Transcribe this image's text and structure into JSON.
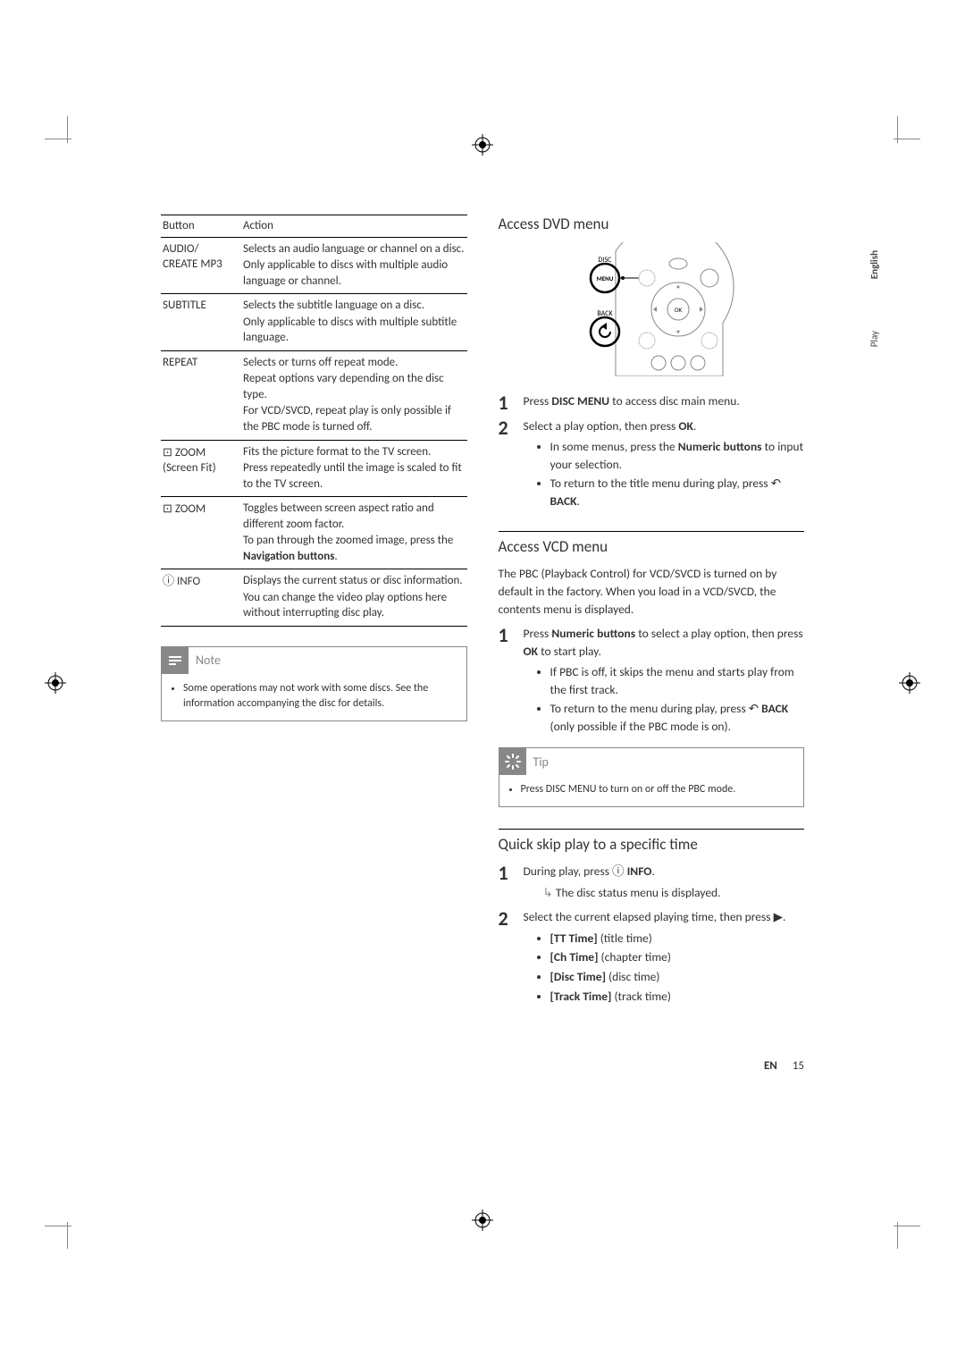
{
  "side_labels": {
    "english": "English",
    "play": "Play"
  },
  "table": {
    "header_button": "Button",
    "header_action": "Action",
    "rows": [
      {
        "button": "AUDIO/\nCREATE MP3",
        "actions": [
          "Selects an audio language or channel on a disc.",
          "Only applicable to discs with multiple audio language or channel."
        ]
      },
      {
        "button": "SUBTITLE",
        "actions": [
          "Selects the subtitle language on a disc.",
          "Only applicable to discs with multiple subtitle language."
        ]
      },
      {
        "button": "REPEAT",
        "actions": [
          "Selects or turns off repeat mode.",
          "Repeat options vary depending on the disc type.",
          "For VCD/SVCD, repeat play is only possible if the PBC mode is turned off."
        ]
      },
      {
        "button_icon": "⊡",
        "button": "ZOOM",
        "button_sub": "(Screen Fit)",
        "actions": [
          "Fits the picture format to the TV screen.",
          "Press repeatedly until the image is scaled to fit to the TV screen."
        ]
      },
      {
        "button_icon": "⊡",
        "button": "ZOOM",
        "actions": [
          "Toggles between screen aspect ratio and different zoom factor.",
          "To pan through the zoomed image, press the <b>Navigation buttons</b>."
        ]
      },
      {
        "button_icon": "ⓘ",
        "button": "INFO",
        "actions": [
          "Displays the current status or disc information.",
          "You can change the video play options here without interrupting disc play."
        ]
      }
    ]
  },
  "note": {
    "title": "Note",
    "items": [
      "Some operations may not work with some discs. See the information accompanying the disc for details."
    ]
  },
  "dvd": {
    "title": "Access DVD menu",
    "remote_labels": {
      "disc": "DISC",
      "menu": "MENU",
      "back": "BACK",
      "ok": "OK"
    },
    "step1": "Press <b>DISC MENU</b> to access disc main menu.",
    "step2": "Select a play option, then press <b>OK</b>.",
    "sub": [
      "In some menus, press the <b>Numeric buttons</b> to input your selection.",
      "To return to the title menu during play, press <span class='icon-glyph'>↶</span> <b>BACK</b>."
    ]
  },
  "vcd": {
    "title": "Access VCD menu",
    "intro": "The PBC (Playback Control) for VCD/SVCD is turned on by default in the factory. When you load in a VCD/SVCD, the contents menu is displayed.",
    "step1": "Press <b>Numeric buttons</b> to select a play option, then press <b>OK</b> to start play.",
    "sub": [
      "If PBC is off, it skips the menu and starts play from the first track.",
      "To return to the menu during play, press <span class='icon-glyph'>↶</span> <b>BACK</b> (only possible if the PBC mode is on)."
    ]
  },
  "tip": {
    "title": "Tip",
    "items": [
      "Press DISC MENU to turn on or off the PBC mode."
    ]
  },
  "quick": {
    "title": "Quick skip play to a specific time",
    "step1": "During play, press <span class='icon-glyph'>ⓘ</span> <b>INFO</b>.",
    "step1_result": "The disc status menu is displayed.",
    "step2": "Select the current elapsed playing time, then press <span class='icon-glyph'>▶</span>.",
    "options": [
      "<b>[TT Time]</b> (title time)",
      "<b>[Ch Time]</b> (chapter time)",
      "<b>[Disc Time]</b> (disc time)",
      "<b>[Track Time]</b> (track time)"
    ]
  },
  "footer": {
    "lang": "EN",
    "page": "15"
  }
}
